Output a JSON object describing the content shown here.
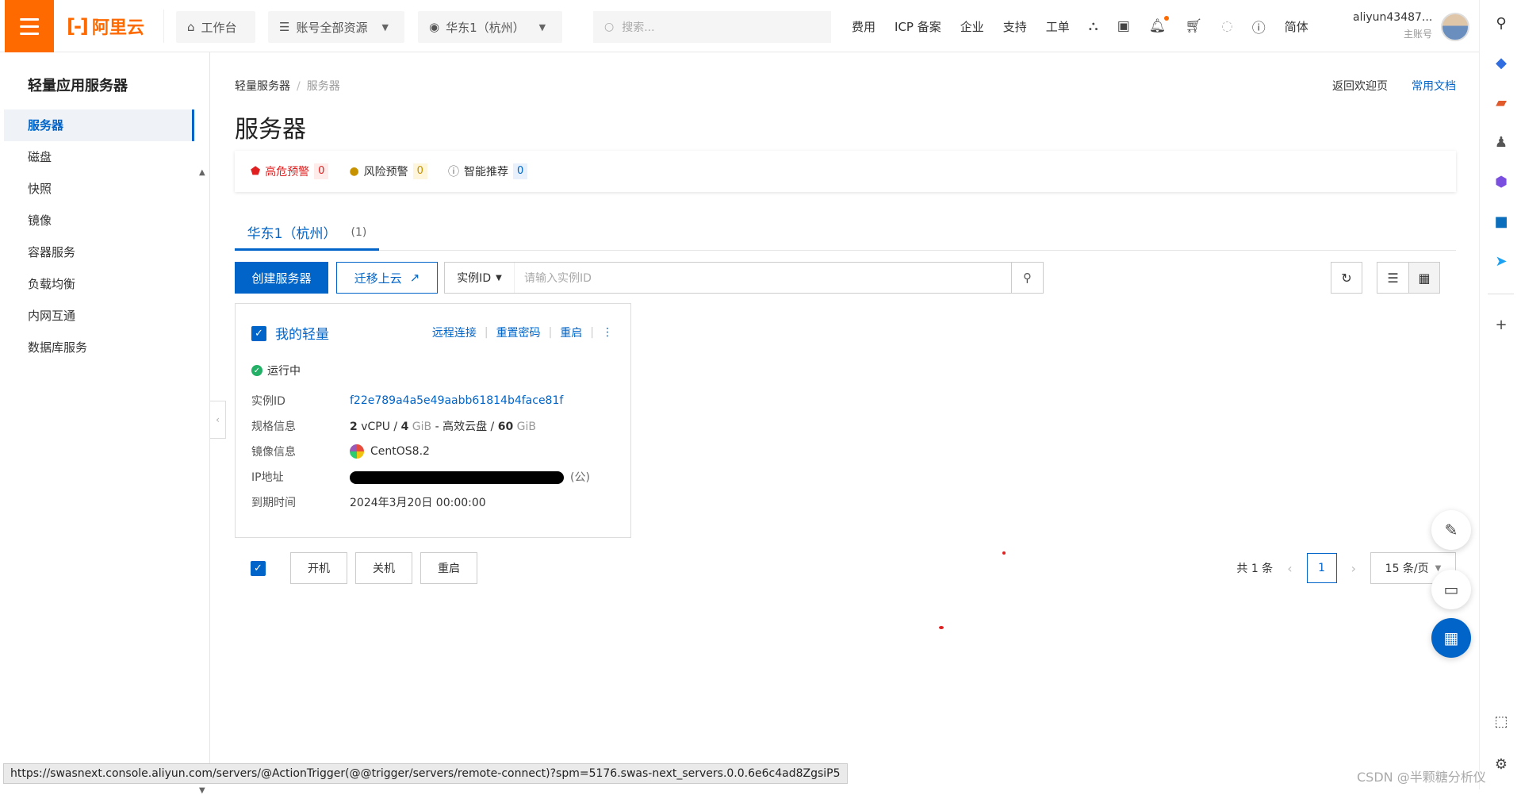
{
  "header": {
    "logo_text": "阿里云",
    "workbench": "工作台",
    "resource_select": "账号全部资源",
    "region_select": "华东1（杭州）",
    "search_placeholder": "搜索...",
    "nav": [
      "费用",
      "ICP 备案",
      "企业",
      "支持",
      "工单"
    ],
    "lang": "简体",
    "user_name": "aliyun43487...",
    "user_role": "主账号"
  },
  "sidebar": {
    "title": "轻量应用服务器",
    "items": [
      "服务器",
      "磁盘",
      "快照",
      "镜像",
      "容器服务",
      "负载均衡",
      "内网互通",
      "数据库服务"
    ],
    "active_index": 0
  },
  "breadcrumb": {
    "root": "轻量服务器",
    "current": "服务器"
  },
  "top_links": {
    "welcome": "返回欢迎页",
    "docs": "常用文档"
  },
  "page_title": "服务器",
  "alerts": [
    {
      "label": "高危预警",
      "count": "0",
      "color": "#e02020"
    },
    {
      "label": "风险预警",
      "count": "0",
      "color": "#c79200"
    },
    {
      "label": "智能推荐",
      "count": "0",
      "color": "#0064c8"
    }
  ],
  "tab": {
    "label": "华东1（杭州）",
    "count": "(1)"
  },
  "toolbar": {
    "create": "创建服务器",
    "migrate": "迁移上云",
    "filter_select": "实例ID",
    "filter_placeholder": "请输入实例ID"
  },
  "card": {
    "name": "我的轻量",
    "actions": [
      "远程连接",
      "重置密码",
      "重启"
    ],
    "status": "运行中",
    "fields": {
      "id_label": "实例ID",
      "id_value": "f22e789a4a5e49aabb61814b4face81f",
      "spec_label": "规格信息",
      "spec_cpu": "2",
      "spec_cpu_unit": "vCPU",
      "spec_mem": "4",
      "spec_mem_unit": "GiB",
      "spec_disk_type": "高效云盘",
      "spec_disk": "60",
      "spec_disk_unit": "GiB",
      "image_label": "镜像信息",
      "image_value": "CentOS8.2",
      "ip_label": "IP地址",
      "ip_suffix": "(公)",
      "expire_label": "到期时间",
      "expire_value": "2024年3月20日 00:00:00"
    }
  },
  "bulk_actions": [
    "开机",
    "关机",
    "重启"
  ],
  "pager": {
    "total": "共 1 条",
    "page": "1",
    "page_size": "15 条/页"
  },
  "statusbar_url": "https://swasnext.console.aliyun.com/servers/@ActionTrigger(@@trigger/servers/remote-connect)?spm=5176.swas-next_servers.0.0.6e6c4ad8ZgsiP5",
  "watermark": "CSDN @半颗糖分析仪",
  "colors": {
    "brand": "#ff6a00",
    "primary": "#0064c8",
    "success": "#23b066"
  }
}
